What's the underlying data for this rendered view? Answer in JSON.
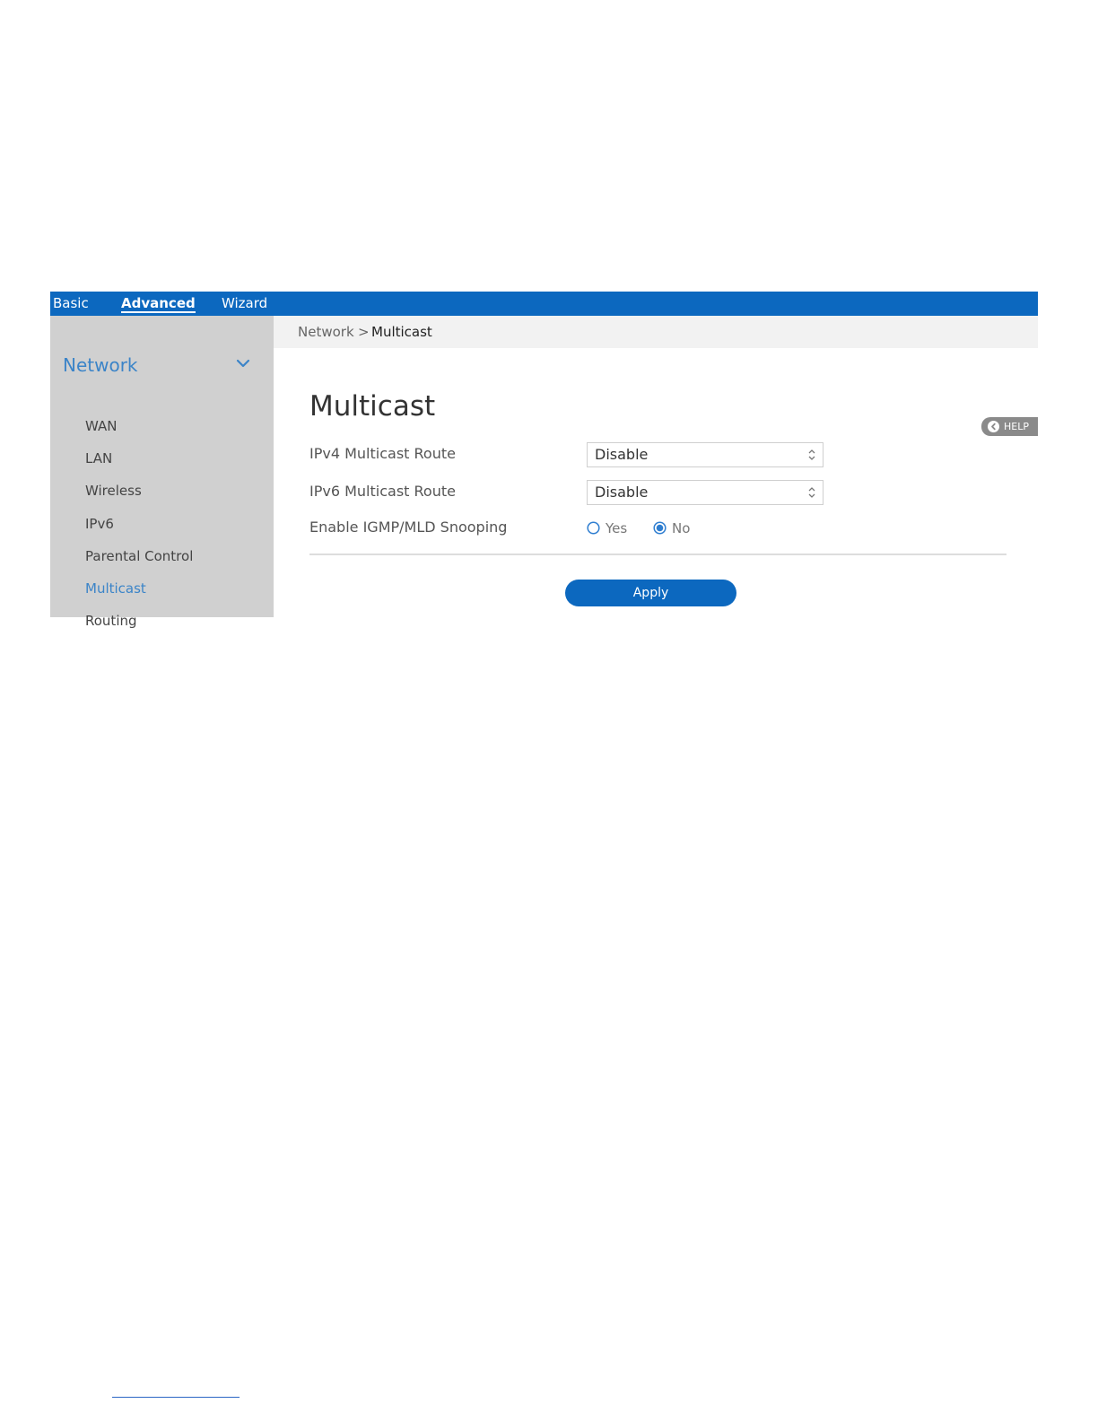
{
  "topnav": {
    "tabs": [
      {
        "label": "Basic"
      },
      {
        "label": "Advanced"
      },
      {
        "label": "Wizard"
      }
    ],
    "active_tab": "Advanced"
  },
  "sidebar": {
    "section_label": "Network",
    "items": [
      {
        "label": "WAN"
      },
      {
        "label": "LAN"
      },
      {
        "label": "Wireless"
      },
      {
        "label": "IPv6"
      },
      {
        "label": "Parental Control"
      },
      {
        "label": "Multicast"
      },
      {
        "label": "Routing"
      }
    ],
    "active_item": "Multicast"
  },
  "breadcrumb": {
    "parent": "Network",
    "separator": ">",
    "current": "Multicast"
  },
  "page": {
    "title": "Multicast",
    "help_label": "HELP"
  },
  "form": {
    "ipv4_route": {
      "label": "IPv4 Multicast Route",
      "value": "Disable"
    },
    "ipv6_route": {
      "label": "IPv6 Multicast Route",
      "value": "Disable"
    },
    "snooping": {
      "label": "Enable IGMP/MLD Snooping",
      "options": [
        {
          "label": "Yes",
          "selected": false
        },
        {
          "label": "No",
          "selected": true
        }
      ]
    },
    "apply_label": "Apply"
  },
  "colors": {
    "accent": "#0c68bf",
    "link": "#3b84c8",
    "sidebar_bg": "#d0d0d0"
  }
}
